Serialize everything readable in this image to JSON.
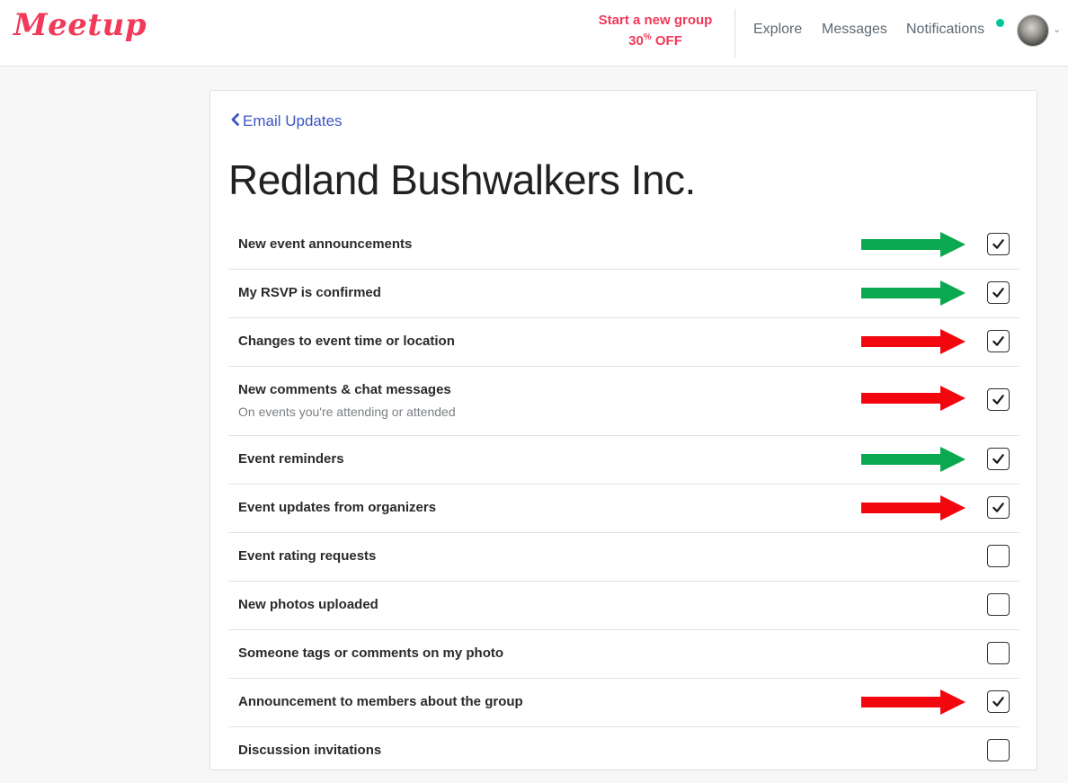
{
  "brand": {
    "logo_text": "Meetup",
    "accent_color": "#f13a59"
  },
  "nav": {
    "promo_line1": "Start a new group",
    "promo_pct": "30",
    "promo_pct_sup": "%",
    "promo_off": "OFF",
    "explore": "Explore",
    "messages": "Messages",
    "notifications": "Notifications",
    "notification_dot_color": "#00c798"
  },
  "page": {
    "back_link": "Email Updates",
    "title": "Redland Bushwalkers Inc."
  },
  "settings": [
    {
      "label": "New event announcements",
      "sublabel": "",
      "checked": true,
      "arrow": "green"
    },
    {
      "label": "My RSVP is confirmed",
      "sublabel": "",
      "checked": true,
      "arrow": "green"
    },
    {
      "label": "Changes to event time or location",
      "sublabel": "",
      "checked": true,
      "arrow": "red"
    },
    {
      "label": "New comments & chat messages",
      "sublabel": "On events you're attending or attended",
      "checked": true,
      "arrow": "red"
    },
    {
      "label": "Event reminders",
      "sublabel": "",
      "checked": true,
      "arrow": "green"
    },
    {
      "label": "Event updates from organizers",
      "sublabel": "",
      "checked": true,
      "arrow": "red"
    },
    {
      "label": "Event rating requests",
      "sublabel": "",
      "checked": false,
      "arrow": ""
    },
    {
      "label": "New photos uploaded",
      "sublabel": "",
      "checked": false,
      "arrow": ""
    },
    {
      "label": "Someone tags or comments on my photo",
      "sublabel": "",
      "checked": false,
      "arrow": ""
    },
    {
      "label": "Announcement to members about the group",
      "sublabel": "",
      "checked": true,
      "arrow": "red"
    },
    {
      "label": "Discussion invitations",
      "sublabel": "",
      "checked": false,
      "arrow": ""
    }
  ],
  "arrow_colors": {
    "green": "#0aa84f",
    "red": "#f2070f"
  }
}
